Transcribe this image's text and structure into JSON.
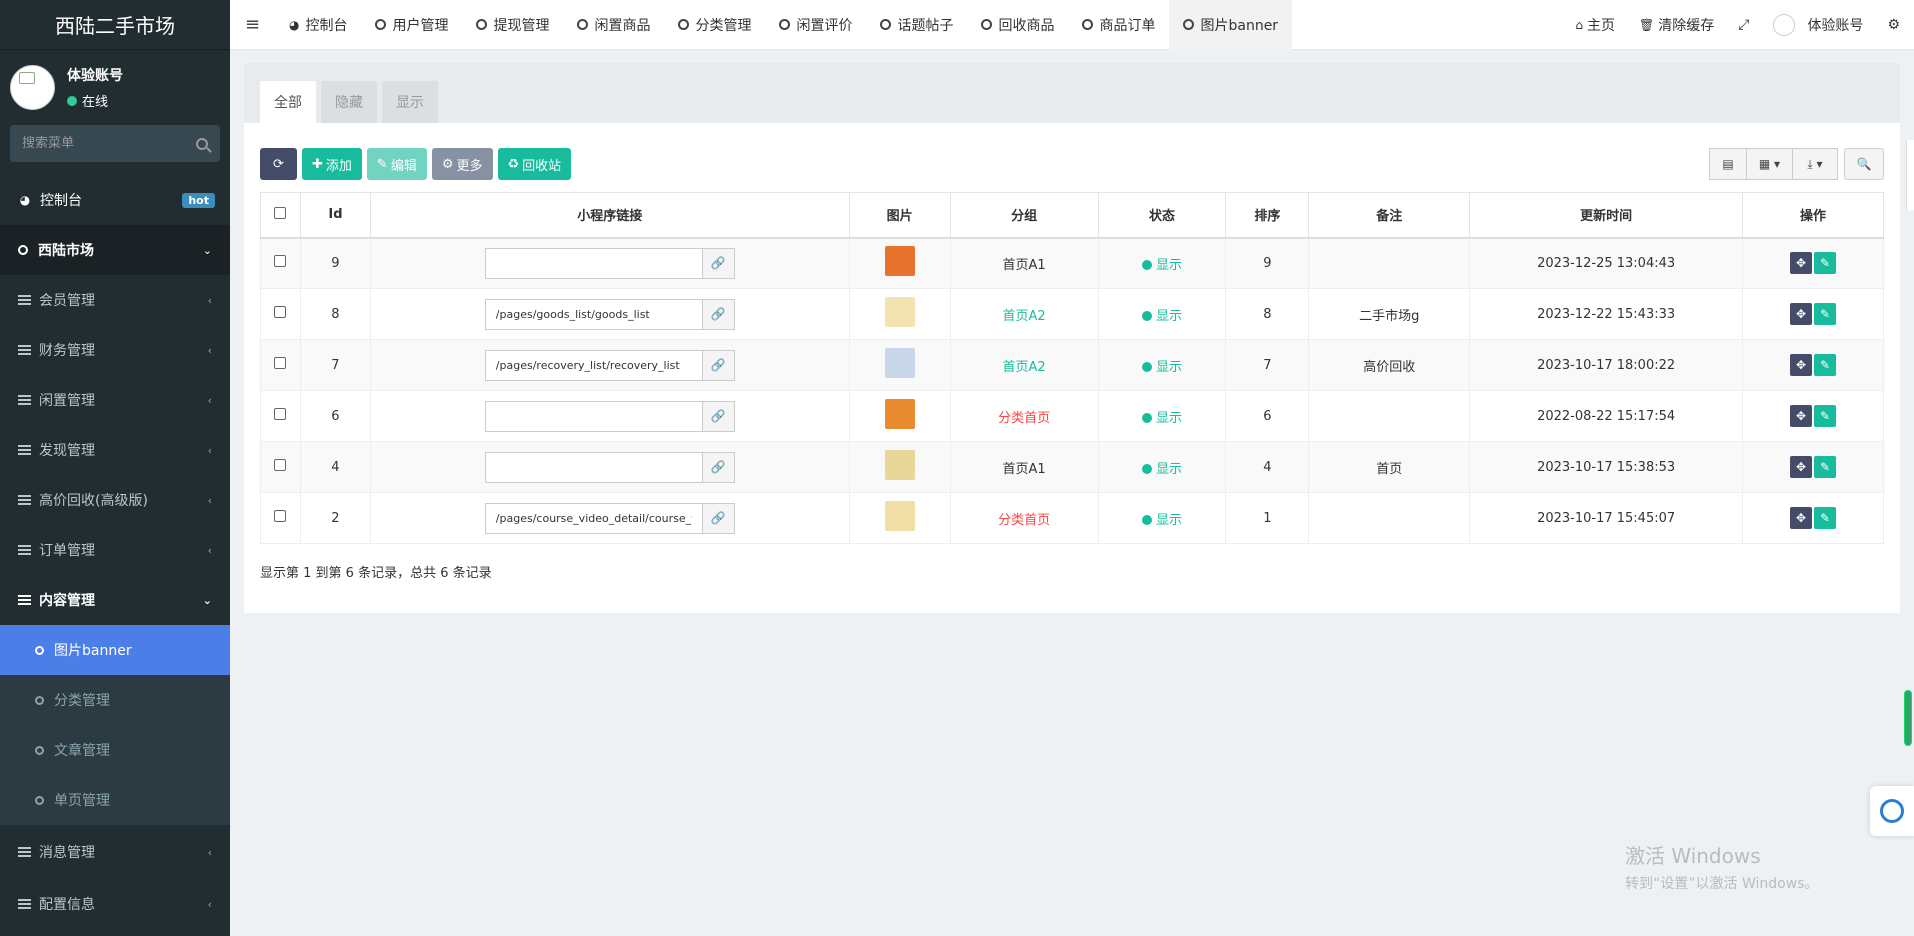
{
  "app": {
    "title": "西陆二手市场",
    "username": "体验账号",
    "status": "在线"
  },
  "search": {
    "placeholder": "搜索菜单"
  },
  "sidebar": {
    "dashboard": {
      "label": "控制台",
      "badge": "hot"
    },
    "market": "西陆市场",
    "groups": [
      "会员管理",
      "财务管理",
      "闲置管理",
      "发现管理",
      "高价回收(高级版)",
      "订单管理"
    ],
    "content_group": "内容管理",
    "content_items": [
      "图片banner",
      "分类管理",
      "文章管理",
      "单页管理"
    ],
    "bottom_groups": [
      "消息管理",
      "配置信息"
    ]
  },
  "topnav": {
    "tabs": [
      "控制台",
      "用户管理",
      "提现管理",
      "闲置商品",
      "分类管理",
      "闲置评价",
      "话题帖子",
      "回收商品",
      "商品订单",
      "图片banner"
    ],
    "home": "主页",
    "clear_cache": "清除缓存",
    "user": "体验账号"
  },
  "panel": {
    "tabs": [
      "全部",
      "隐藏",
      "显示"
    ],
    "buttons": {
      "add": "添加",
      "edit": "编辑",
      "more": "更多",
      "recycle": "回收站"
    }
  },
  "table": {
    "headers": [
      "Id",
      "小程序链接",
      "图片",
      "分组",
      "状态",
      "排序",
      "备注",
      "更新时间",
      "操作"
    ],
    "rows": [
      {
        "id": "9",
        "link": "",
        "group": "首页A1",
        "group_color": "default",
        "status": "显示",
        "sort": "9",
        "remark": "",
        "updated": "2023-12-25 13:04:43",
        "thumb": "#e8732e"
      },
      {
        "id": "8",
        "link": "/pages/goods_list/goods_list",
        "group": "首页A2",
        "group_color": "green",
        "status": "显示",
        "sort": "8",
        "remark": "二手市场g",
        "updated": "2023-12-22 15:43:33",
        "thumb": "#f3e3b0"
      },
      {
        "id": "7",
        "link": "/pages/recovery_list/recovery_list",
        "group": "首页A2",
        "group_color": "green",
        "status": "显示",
        "sort": "7",
        "remark": "高价回收",
        "updated": "2023-10-17 18:00:22",
        "thumb": "#c9d6ea"
      },
      {
        "id": "6",
        "link": "",
        "group": "分类首页",
        "group_color": "red",
        "status": "显示",
        "sort": "6",
        "remark": "",
        "updated": "2022-08-22 15:17:54",
        "thumb": "#e88a2e"
      },
      {
        "id": "4",
        "link": "",
        "group": "首页A1",
        "group_color": "default",
        "status": "显示",
        "sort": "4",
        "remark": "首页",
        "updated": "2023-10-17 15:38:53",
        "thumb": "#e9d79a"
      },
      {
        "id": "2",
        "link": "/pages/course_video_detail/course_v",
        "group": "分类首页",
        "group_color": "red",
        "status": "显示",
        "sort": "1",
        "remark": "",
        "updated": "2023-10-17 15:45:07",
        "thumb": "#efdfa6"
      }
    ]
  },
  "pager": {
    "info": "显示第 1 到第 6 条记录，总共 6 条记录"
  },
  "watermark": {
    "line1": "激活 Windows",
    "line2": "转到“设置”以激活 Windows。"
  }
}
